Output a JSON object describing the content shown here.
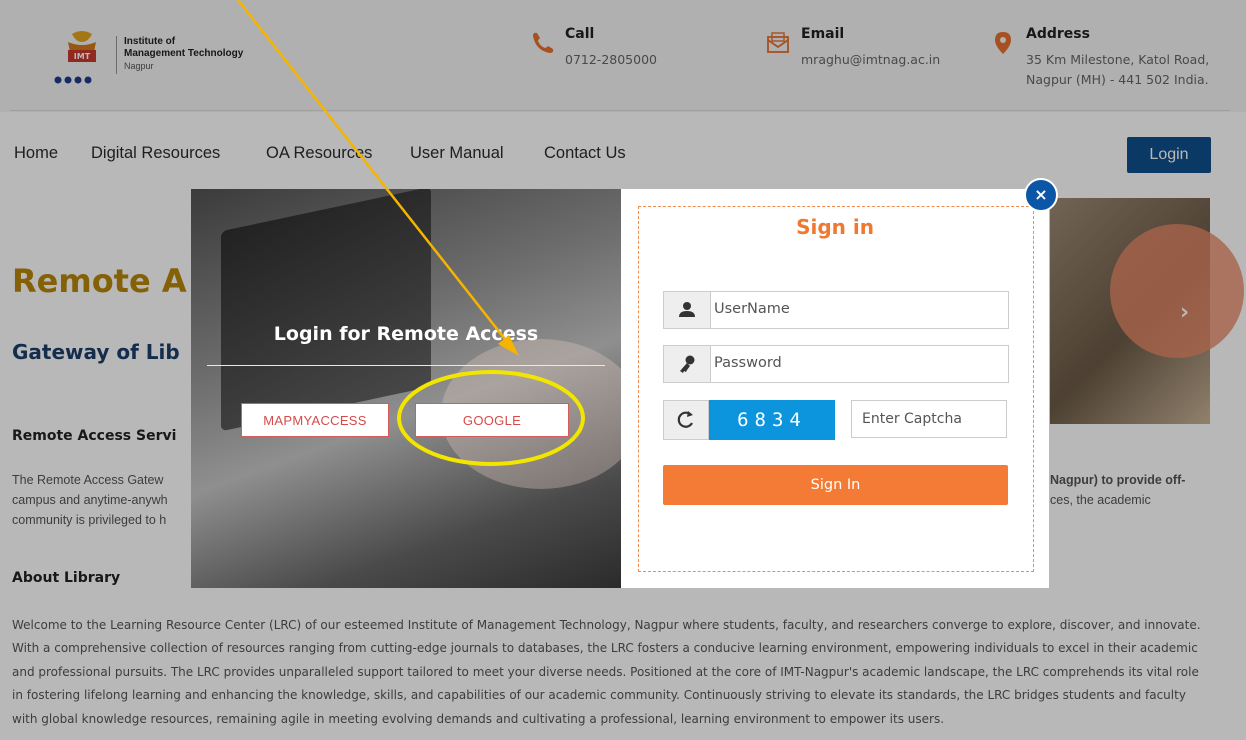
{
  "header": {
    "logo": {
      "line1": "Institute of",
      "line2": "Management Technology",
      "line3": "Nagpur",
      "mark_text": "IMT"
    },
    "call": {
      "title": "Call",
      "value": "0712-2805000",
      "icon": "phone-icon"
    },
    "email": {
      "title": "Email",
      "value": "mraghu@imtnag.ac.in",
      "icon": "envelope-icon"
    },
    "address": {
      "title": "Address",
      "line1": "35 Km Milestone, Katol Road,",
      "line2": "Nagpur (MH) - 441 502 India.",
      "icon": "map-pin-icon"
    }
  },
  "nav": {
    "items": [
      "Home",
      "Digital Resources",
      "OA Resources",
      "User Manual",
      "Contact Us"
    ],
    "login_label": "Login"
  },
  "main": {
    "hero_title": "Remote A",
    "hero_subtitle": "Gateway of Lib",
    "remote_heading": "Remote Access Servi",
    "remote_lines_left": [
      "The Remote Access Gatew",
      "campus and anytime-anywh",
      "community is privileged to h"
    ],
    "remote_lines_right": [
      "Nagpur) to provide off-",
      "ces, the academic"
    ],
    "about_heading": "About Library",
    "about_lines": [
      "Welcome to the Learning Resource Center (LRC) of our esteemed Institute of Management Technology, Nagpur where students, faculty, and researchers converge to explore, discover, and innovate.",
      "With a comprehensive collection of resources ranging from cutting-edge journals to databases, the LRC fosters a conducive learning environment, empowering individuals to excel in their academic",
      "and professional pursuits. The LRC provides unparalleled support tailored to meet your diverse needs. Positioned at the core of IMT-Nagpur's academic landscape, the LRC comprehends its vital role",
      "in fostering lifelong learning and enhancing the knowledge, skills, and capabilities of our academic community. Continuously striving to elevate its standards, the LRC bridges students and faculty",
      "with global knowledge resources, remaining agile in meeting evolving demands and cultivating a professional, learning environment to empower its users."
    ]
  },
  "modal": {
    "left": {
      "title": "Login for Remote Access",
      "mapmyaccess_label": "MAPMYACCESS",
      "google_label": "GOOGLE"
    },
    "right": {
      "title": "Sign in",
      "username_placeholder": "UserName",
      "password_placeholder": "Password",
      "captcha_code": "6834",
      "captcha_placeholder": "Enter Captcha",
      "submit_label": "Sign In"
    },
    "close_label": "×"
  },
  "colors": {
    "accent_orange": "#f47b36",
    "brand_blue": "#10508e",
    "captcha_blue": "#0c95dd",
    "annotation_arrow": "#f5b400",
    "annotation_ellipse": "#f2e600"
  }
}
